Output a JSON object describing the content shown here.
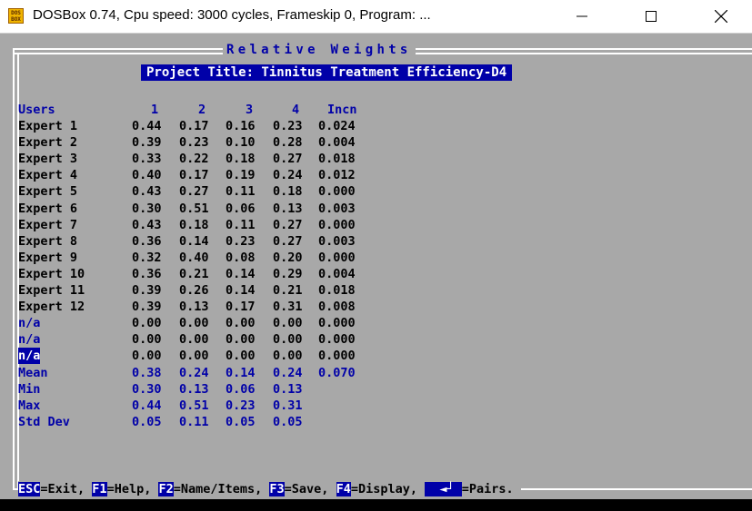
{
  "window": {
    "title": "DOSBox 0.74, Cpu speed:    3000 cycles, Frameskip  0, Program: ..."
  },
  "screen": {
    "header": "Relative Weights",
    "project_title": "Project Title: Tinnitus Treatment Efficiency-D4",
    "columns": [
      "Users",
      "1",
      "2",
      "3",
      "4",
      "Incn"
    ],
    "rows": [
      {
        "label": "Expert 1",
        "values": [
          "0.44",
          "0.17",
          "0.16",
          "0.23",
          "0.024"
        ]
      },
      {
        "label": "Expert 2",
        "values": [
          "0.39",
          "0.23",
          "0.10",
          "0.28",
          "0.004"
        ]
      },
      {
        "label": "Expert 3",
        "values": [
          "0.33",
          "0.22",
          "0.18",
          "0.27",
          "0.018"
        ]
      },
      {
        "label": "Expert 4",
        "values": [
          "0.40",
          "0.17",
          "0.19",
          "0.24",
          "0.012"
        ]
      },
      {
        "label": "Expert 5",
        "values": [
          "0.43",
          "0.27",
          "0.11",
          "0.18",
          "0.000"
        ]
      },
      {
        "label": "Expert 6",
        "values": [
          "0.30",
          "0.51",
          "0.06",
          "0.13",
          "0.003"
        ]
      },
      {
        "label": "Expert 7",
        "values": [
          "0.43",
          "0.18",
          "0.11",
          "0.27",
          "0.000"
        ]
      },
      {
        "label": "Expert 8",
        "values": [
          "0.36",
          "0.14",
          "0.23",
          "0.27",
          "0.003"
        ]
      },
      {
        "label": "Expert 9",
        "values": [
          "0.32",
          "0.40",
          "0.08",
          "0.20",
          "0.000"
        ]
      },
      {
        "label": "Expert 10",
        "values": [
          "0.36",
          "0.21",
          "0.14",
          "0.29",
          "0.004"
        ]
      },
      {
        "label": "Expert 11",
        "values": [
          "0.39",
          "0.26",
          "0.14",
          "0.21",
          "0.018"
        ]
      },
      {
        "label": "Expert 12",
        "values": [
          "0.39",
          "0.13",
          "0.17",
          "0.31",
          "0.008"
        ]
      },
      {
        "label": "n/a",
        "values": [
          "0.00",
          "0.00",
          "0.00",
          "0.00",
          "0.000"
        ]
      },
      {
        "label": "n/a",
        "values": [
          "0.00",
          "0.00",
          "0.00",
          "0.00",
          "0.000"
        ]
      },
      {
        "label": "n/a",
        "values": [
          "0.00",
          "0.00",
          "0.00",
          "0.00",
          "0.000"
        ]
      }
    ],
    "stats": [
      {
        "label": "Mean",
        "values": [
          "0.38",
          "0.24",
          "0.14",
          "0.24",
          "0.070"
        ]
      },
      {
        "label": "Min",
        "values": [
          "0.30",
          "0.13",
          "0.06",
          "0.13",
          ""
        ]
      },
      {
        "label": "Max",
        "values": [
          "0.44",
          "0.51",
          "0.23",
          "0.31",
          ""
        ]
      },
      {
        "label": "Std Dev",
        "values": [
          "0.05",
          "0.11",
          "0.05",
          "0.05",
          ""
        ]
      }
    ],
    "footer": {
      "esc_key": "ESC",
      "esc_label": "=Exit, ",
      "f1_key": "F1",
      "f1_label": "=Help, ",
      "f2_key": "F2",
      "f2_label": "=Name/Items, ",
      "f3_key": "F3",
      "f3_label": "=Save, ",
      "f4_key": "F4",
      "f4_label": "=Display, ",
      "enter_key": "  ◄┘ ",
      "enter_label": "=Pairs. "
    },
    "colors": {
      "screen_bg": "#a8a8a8",
      "blue": "#0000a8",
      "text": "#000000",
      "highlight_text": "#ffffff"
    },
    "icons": [
      "dosbox-app-icon",
      "minimize-icon",
      "maximize-icon",
      "close-icon",
      "enter-key-icon"
    ]
  }
}
